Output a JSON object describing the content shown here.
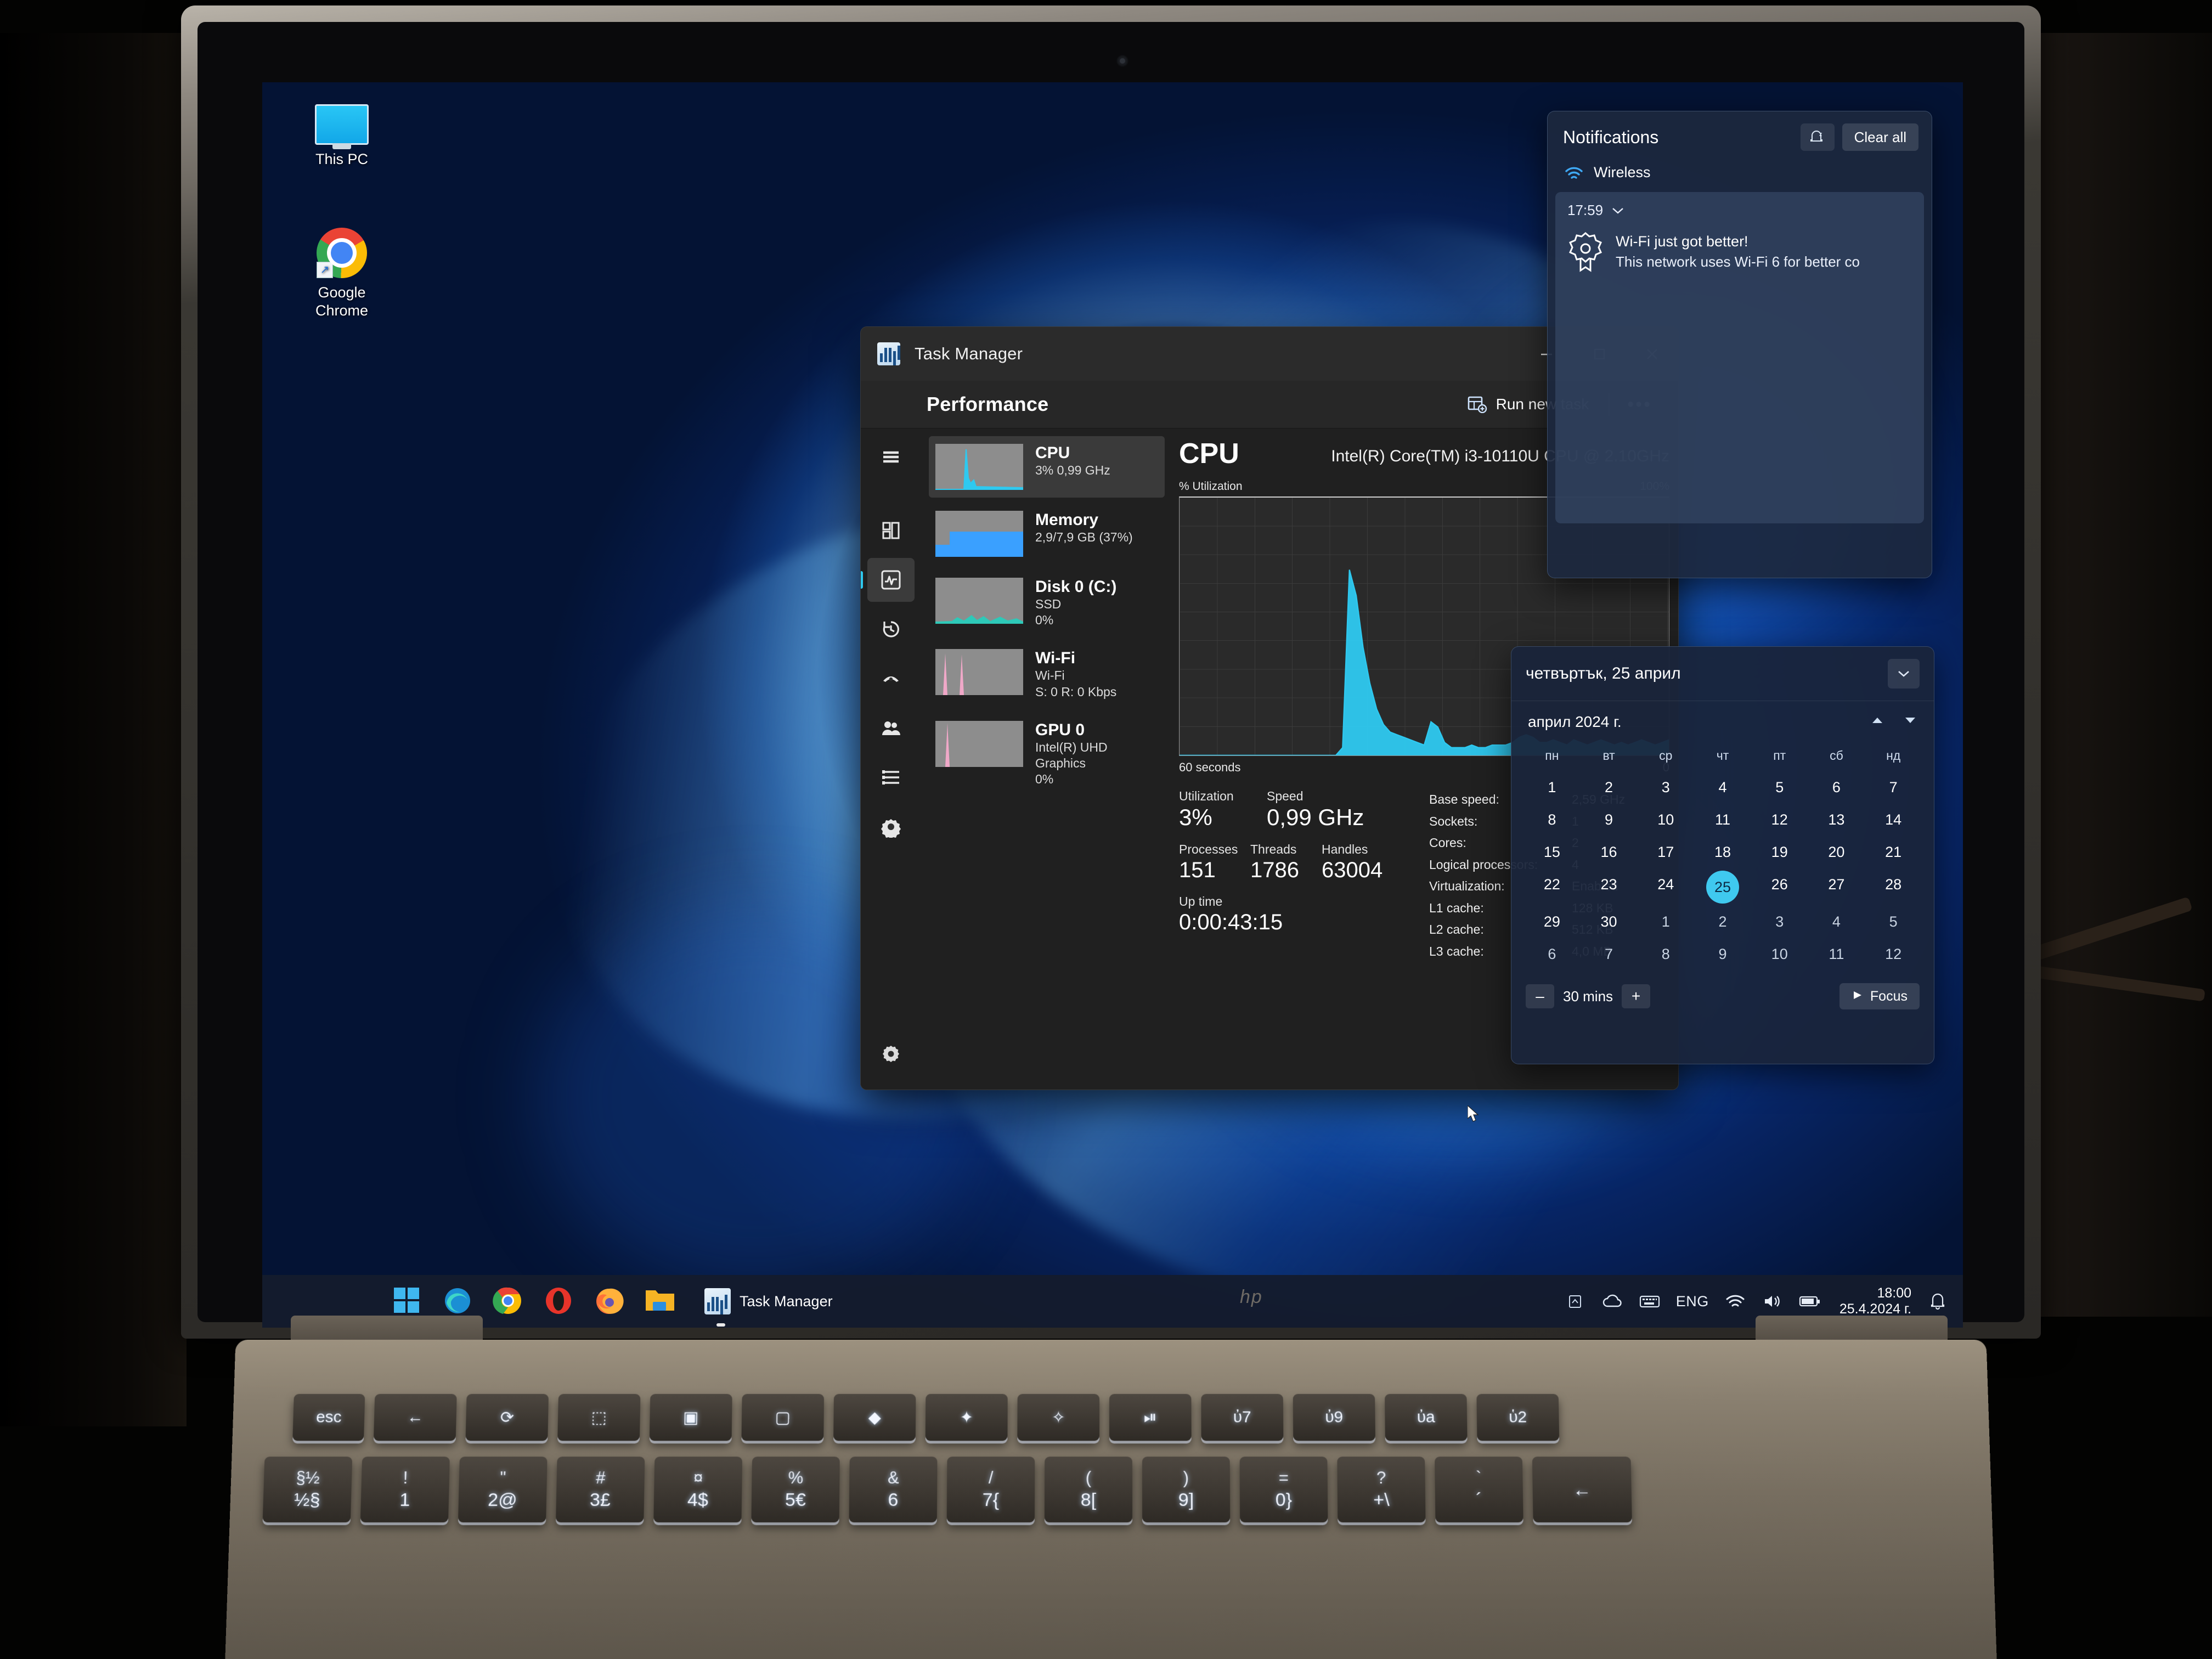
{
  "desktop": {
    "icons": [
      {
        "label": "This PC",
        "icon": "monitor-icon"
      },
      {
        "label": "Google Chrome",
        "icon": "chrome-icon"
      }
    ]
  },
  "task_manager": {
    "window_title": "Task Manager",
    "app_icon": "task-manager-icon",
    "window_buttons": {
      "minimize": "minimize-icon",
      "maximize": "maximize-icon",
      "close": "close-icon"
    },
    "page_title": "Performance",
    "toolbar": {
      "run_new_task": "Run new task",
      "run_new_task_icon": "new-task-icon",
      "more_options": "•••"
    },
    "nav": [
      {
        "name": "hamburger",
        "icon": "hamburger-icon",
        "selected": false
      },
      {
        "name": "processes",
        "icon": "processes-icon",
        "selected": false
      },
      {
        "name": "performance",
        "icon": "performance-icon",
        "selected": true
      },
      {
        "name": "app-history",
        "icon": "app-history-icon",
        "selected": false
      },
      {
        "name": "startup-apps",
        "icon": "startup-apps-icon",
        "selected": false
      },
      {
        "name": "users",
        "icon": "users-icon",
        "selected": false
      },
      {
        "name": "details",
        "icon": "details-icon",
        "selected": false
      },
      {
        "name": "services",
        "icon": "services-icon",
        "selected": false
      },
      {
        "name": "settings",
        "icon": "gear-icon",
        "selected": false
      }
    ],
    "resources": [
      {
        "title": "CPU",
        "line1": "3%  0,99 GHz",
        "line2": "",
        "selected": true,
        "color": "#2ec9f0"
      },
      {
        "title": "Memory",
        "line1": "2,9/7,9 GB (37%)",
        "line2": "",
        "selected": false,
        "color": "#3aa0ff"
      },
      {
        "title": "Disk 0 (C:)",
        "line1": "SSD",
        "line2": "0%",
        "selected": false,
        "color": "#2ec9b8"
      },
      {
        "title": "Wi-Fi",
        "line1": "Wi-Fi",
        "line2": "S: 0 R: 0 Kbps",
        "selected": false,
        "color": "#f0a8c8"
      },
      {
        "title": "GPU 0",
        "line1": "Intel(R) UHD Graphics",
        "line2": "0%",
        "selected": false,
        "color": "#f0a8c8"
      }
    ],
    "detail": {
      "heading": "CPU",
      "model": "Intel(R) Core(TM) i3-10110U CPU @ 2.10GHz",
      "graph_y_label": "% Utilization",
      "graph_y_max": "100%",
      "graph_x_left": "60 seconds",
      "graph_x_right": "0",
      "stats": [
        {
          "label": "Utilization",
          "value": "3%"
        },
        {
          "label": "Speed",
          "value": "0,99 GHz"
        },
        {
          "label": "Processes",
          "value": "151"
        },
        {
          "label": "Threads",
          "value": "1786"
        },
        {
          "label": "Handles",
          "value": "63004"
        },
        {
          "label": "Up time",
          "value": "0:00:43:15"
        }
      ],
      "specs": [
        {
          "key": "Base speed:",
          "value": "2,59 GHz"
        },
        {
          "key": "Sockets:",
          "value": "1"
        },
        {
          "key": "Cores:",
          "value": "2"
        },
        {
          "key": "Logical processors:",
          "value": "4"
        },
        {
          "key": "Virtualization:",
          "value": "Enabled"
        },
        {
          "key": "L1 cache:",
          "value": "128 KB"
        },
        {
          "key": "L2 cache:",
          "value": "512 KB"
        },
        {
          "key": "L3 cache:",
          "value": "4,0 MB"
        }
      ]
    }
  },
  "notifications": {
    "title": "Notifications",
    "clear_all": "Clear all",
    "focus_assist_icon": "do-not-disturb-icon",
    "group_label": "Wireless",
    "group_icon": "wifi-icon",
    "item": {
      "time": "17:59",
      "chevron": "chevron-down-icon",
      "icon": "badge-icon",
      "title": "Wi-Fi just got better!",
      "body": "This network uses Wi-Fi 6 for better co"
    }
  },
  "calendar": {
    "header_date": "четвъртък, 25 април",
    "collapse_icon": "chevron-down-icon",
    "month": "април 2024 г.",
    "prev_icon": "caret-up-icon",
    "next_icon": "caret-down-icon",
    "dow": [
      "пн",
      "вт",
      "ср",
      "чт",
      "пт",
      "сб",
      "нд"
    ],
    "weeks": [
      [
        {
          "d": "1"
        },
        {
          "d": "2"
        },
        {
          "d": "3"
        },
        {
          "d": "4"
        },
        {
          "d": "5"
        },
        {
          "d": "6"
        },
        {
          "d": "7"
        }
      ],
      [
        {
          "d": "8"
        },
        {
          "d": "9"
        },
        {
          "d": "10"
        },
        {
          "d": "11"
        },
        {
          "d": "12"
        },
        {
          "d": "13"
        },
        {
          "d": "14"
        }
      ],
      [
        {
          "d": "15"
        },
        {
          "d": "16"
        },
        {
          "d": "17"
        },
        {
          "d": "18"
        },
        {
          "d": "19"
        },
        {
          "d": "20"
        },
        {
          "d": "21"
        }
      ],
      [
        {
          "d": "22"
        },
        {
          "d": "23"
        },
        {
          "d": "24"
        },
        {
          "d": "25",
          "today": true
        },
        {
          "d": "26"
        },
        {
          "d": "27"
        },
        {
          "d": "28"
        }
      ],
      [
        {
          "d": "29"
        },
        {
          "d": "30"
        },
        {
          "d": "1",
          "dim": true
        },
        {
          "d": "2",
          "dim": true
        },
        {
          "d": "3",
          "dim": true
        },
        {
          "d": "4",
          "dim": true
        },
        {
          "d": "5",
          "dim": true
        }
      ],
      [
        {
          "d": "6",
          "dim": true
        },
        {
          "d": "7",
          "dim": true
        },
        {
          "d": "8",
          "dim": true
        },
        {
          "d": "9",
          "dim": true
        },
        {
          "d": "10",
          "dim": true
        },
        {
          "d": "11",
          "dim": true
        },
        {
          "d": "12",
          "dim": true
        }
      ]
    ],
    "focus": {
      "minus": "–",
      "duration": "30 mins",
      "plus": "+",
      "button": "Focus",
      "play_icon": "play-icon"
    }
  },
  "taskbar": {
    "pinned": [
      {
        "name": "start",
        "icon": "windows-logo-icon"
      },
      {
        "name": "edge",
        "icon": "edge-icon"
      },
      {
        "name": "chrome",
        "icon": "chrome-icon"
      },
      {
        "name": "opera",
        "icon": "opera-icon"
      },
      {
        "name": "firefox",
        "icon": "firefox-icon"
      },
      {
        "name": "file-explorer",
        "icon": "folder-icon"
      }
    ],
    "active_task": {
      "label": "Task Manager",
      "icon": "task-manager-icon"
    },
    "tray": [
      {
        "name": "show-hidden-icons",
        "icon": "chevron-up-icon"
      },
      {
        "name": "onedrive",
        "icon": "cloud-icon"
      },
      {
        "name": "touch-keyboard",
        "icon": "keyboard-icon"
      },
      {
        "name": "language",
        "icon": "text-label",
        "text": "ENG"
      },
      {
        "name": "network",
        "icon": "wifi-icon"
      },
      {
        "name": "volume",
        "icon": "speaker-icon"
      },
      {
        "name": "battery",
        "icon": "battery-icon"
      }
    ],
    "clock": {
      "time": "18:00",
      "date": "25.4.2024 г."
    },
    "notification_bell": "bell-icon"
  },
  "keyboard": {
    "fn_row": [
      "esc",
      "←",
      "⟳",
      "⬚",
      "▣",
      "▢",
      "◆",
      "✦",
      "✧",
      "⏯",
      "ὐ7",
      "ὐ9",
      "ὐa",
      "ὑ2"
    ],
    "num_row": [
      {
        "top": "§½",
        "bot": "½§"
      },
      {
        "top": "!",
        "bot": "1"
      },
      {
        "top": "\"",
        "bot": "2@"
      },
      {
        "top": "#",
        "bot": "3£"
      },
      {
        "top": "¤",
        "bot": "4$"
      },
      {
        "top": "%",
        "bot": "5€"
      },
      {
        "top": "&",
        "bot": "6"
      },
      {
        "top": "/",
        "bot": "7{"
      },
      {
        "top": "(",
        "bot": "8["
      },
      {
        "top": ")",
        "bot": "9]"
      },
      {
        "top": "=",
        "bot": "0}"
      },
      {
        "top": "?",
        "bot": "+\\"
      },
      {
        "top": "`",
        "bot": "´"
      },
      {
        "top": "",
        "bot": "←"
      }
    ],
    "brand": "hp"
  },
  "chart_data": {
    "type": "area",
    "title": "% Utilization",
    "xlabel": "60 seconds",
    "ylabel": "% Utilization",
    "ylim": [
      0,
      100
    ],
    "xlim": [
      60,
      0
    ],
    "x_left_label": "60 seconds",
    "x_right_label": "0",
    "grid": true,
    "series": [
      {
        "name": "CPU",
        "color": "#2ec9f0",
        "values": [
          0,
          0,
          0,
          0,
          0,
          0,
          0,
          0,
          0,
          0,
          0,
          0,
          0,
          0,
          0,
          0,
          0,
          0,
          0,
          0,
          0,
          0,
          0,
          0,
          3,
          72,
          62,
          42,
          28,
          18,
          12,
          9,
          8,
          7,
          6,
          5,
          4,
          13,
          11,
          5,
          3,
          3,
          3,
          4,
          3,
          3,
          4,
          4,
          4,
          5,
          7,
          8,
          7,
          5,
          5,
          6,
          5,
          4,
          6,
          5,
          4,
          5,
          6,
          5,
          4,
          5,
          4,
          5,
          6,
          5,
          4,
          5,
          6
        ]
      }
    ]
  }
}
